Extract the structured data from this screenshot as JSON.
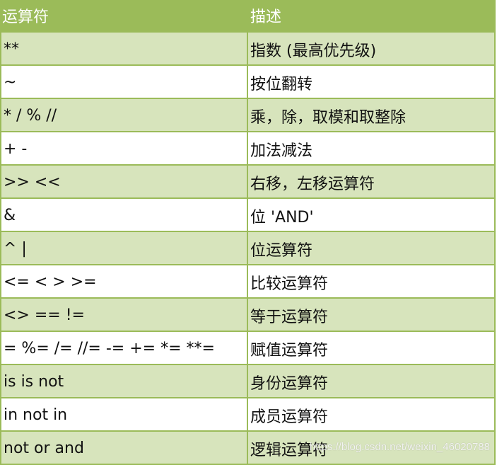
{
  "table": {
    "headers": {
      "operator": "运算符",
      "description": "描述"
    },
    "rows": [
      {
        "operator": "**",
        "description": "指数 (最高优先级)"
      },
      {
        "operator": "~",
        "description": "按位翻转"
      },
      {
        "operator": "* / % //",
        "description": "乘，除，取模和取整除"
      },
      {
        "operator": "+ -",
        "description": "加法减法"
      },
      {
        "operator": ">> <<",
        "description": "右移，左移运算符"
      },
      {
        "operator": "&",
        "description": "位 'AND'"
      },
      {
        "operator": "^ |",
        "description": "位运算符"
      },
      {
        "operator": "<= < > >=",
        "description": "比较运算符"
      },
      {
        "operator": "<> == !=",
        "description": "等于运算符"
      },
      {
        "operator": "= %= /= //= -= += *= **=",
        "description": "赋值运算符"
      },
      {
        "operator": "is is not",
        "description": "身份运算符"
      },
      {
        "operator": "in not in",
        "description": "成员运算符"
      },
      {
        "operator": "not or and",
        "description": "逻辑运算符"
      }
    ]
  },
  "watermark": "https://blog.csdn.net/weixin_46020788",
  "colors": {
    "header_bg": "#9BBB59",
    "alt_row_bg": "#D7E4BC",
    "border": "#9BBB59"
  }
}
